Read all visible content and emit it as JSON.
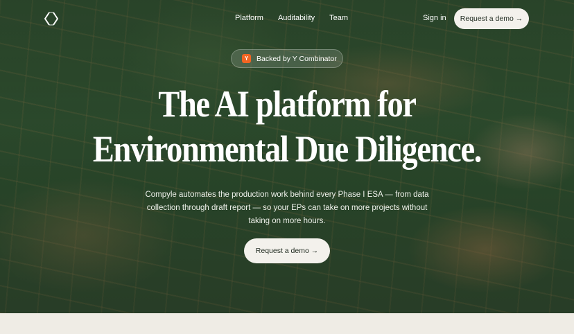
{
  "nav": {
    "logo_icon": "chevron-pair-logo-icon",
    "links": [
      {
        "label": "Platform"
      },
      {
        "label": "Auditability"
      },
      {
        "label": "Team"
      }
    ],
    "sign_in": "Sign in",
    "cta_label": "Request a demo →"
  },
  "badge": {
    "icon_letter": "Y",
    "icon_color": "#f26522",
    "text": "Backed by Y Combinator"
  },
  "hero": {
    "headline_line1": "The AI platform for",
    "headline_line2": "Environmental Due Diligence.",
    "subtitle": "Compyle automates the production work behind every Phase I ESA — from data collection through draft report — so your EPs can take on more projects without taking on more hours.",
    "cta_label": "Request a demo →"
  },
  "colors": {
    "forest_background": "#2d4a2e",
    "button_background": "#f3f1ec",
    "page_background": "#efece5"
  }
}
